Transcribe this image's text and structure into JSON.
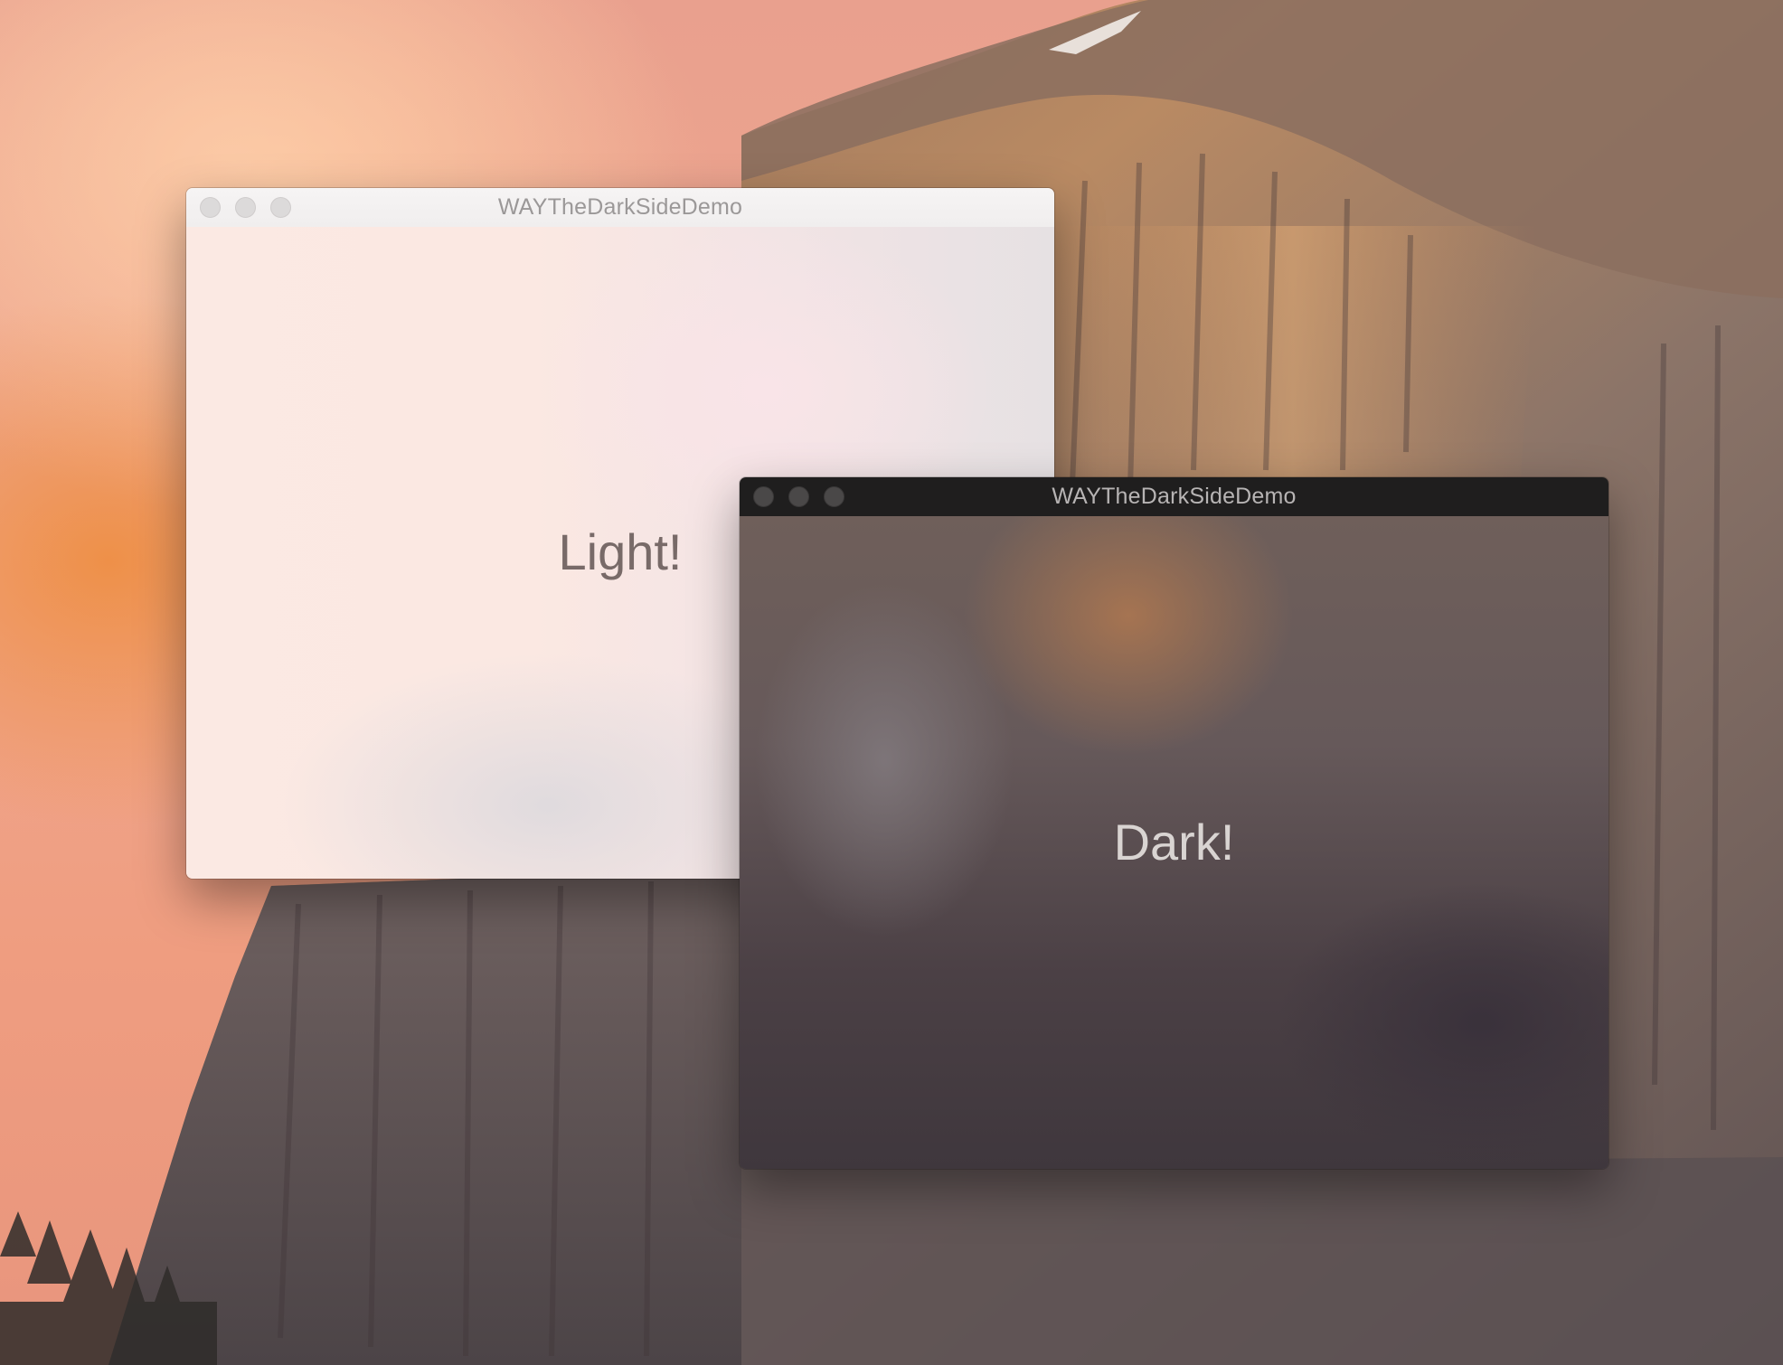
{
  "desktop": {
    "wallpaper": "Yosemite",
    "colors": {
      "sky": "#ef9d80",
      "rock": "#6e5c56"
    }
  },
  "windows": [
    {
      "id": "light",
      "title": "WAYTheDarkSideDemo",
      "label": "Light!",
      "appearance": "light",
      "controls": [
        "close-button",
        "minimize-button",
        "zoom-button"
      ],
      "colors": {
        "titlebar": "#f3f1f1",
        "text": "#786a68"
      }
    },
    {
      "id": "dark",
      "title": "WAYTheDarkSideDemo",
      "label": "Dark!",
      "appearance": "dark",
      "controls": [
        "close-button",
        "minimize-button",
        "zoom-button"
      ],
      "colors": {
        "titlebar": "#1f1e1e",
        "text": "#d9d4d2"
      }
    }
  ]
}
